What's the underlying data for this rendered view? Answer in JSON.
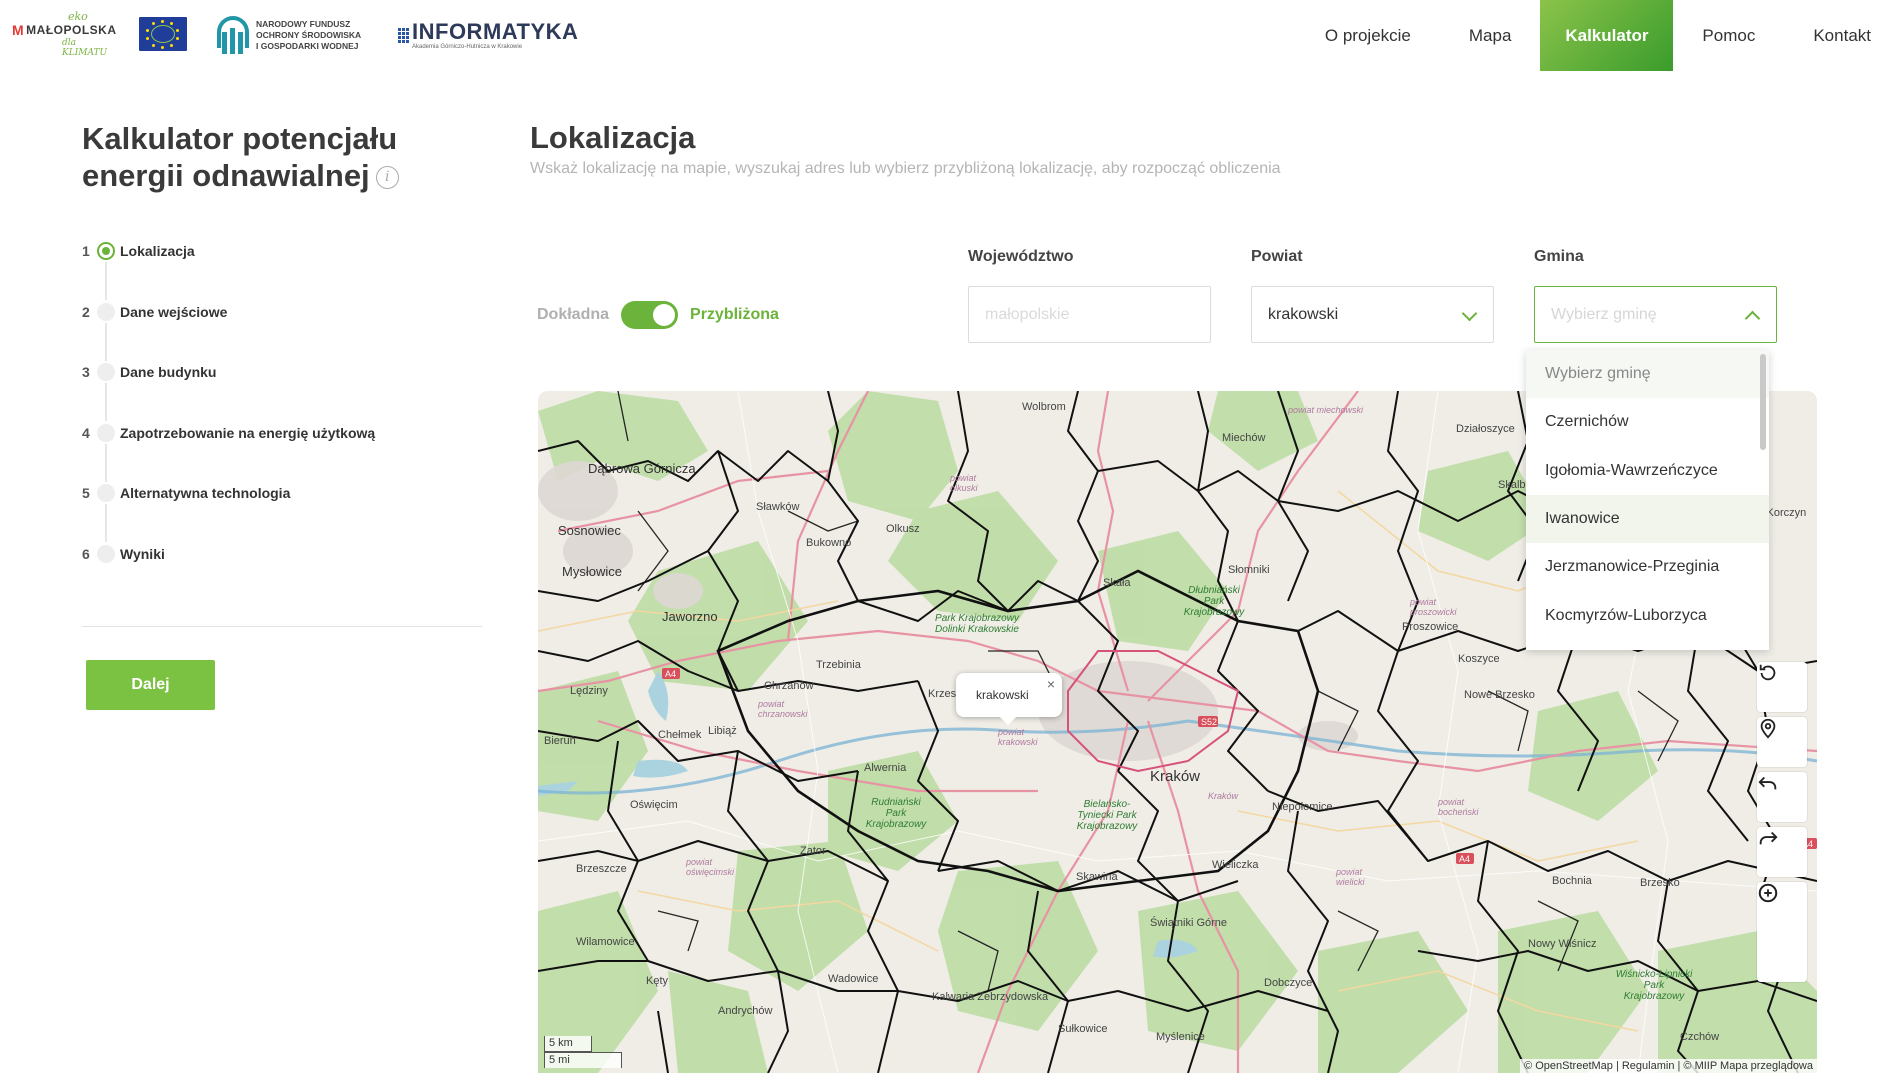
{
  "header": {
    "logos": {
      "malopolska_eko": "eko",
      "malopolska_name": "MAŁOPOLSKA",
      "malopolska_sub": "dla KLIMATU",
      "nfos_line1": "NARODOWY FUNDUSZ",
      "nfos_line2": "OCHRONY ŚRODOWISKA",
      "nfos_line3": "I GOSPODARKI WODNEJ",
      "inf_title": "INFORMATYKA",
      "inf_sub": "Akademia Górniczo-Hutnicza w Krakowie"
    },
    "nav": [
      {
        "label": "O projekcie"
      },
      {
        "label": "Mapa"
      },
      {
        "label": "Kalkulator",
        "active": true
      },
      {
        "label": "Pomoc"
      },
      {
        "label": "Kontakt"
      }
    ]
  },
  "sidebar": {
    "title": "Kalkulator potencjału energii odnawialnej",
    "info_icon": "info-icon",
    "steps": [
      {
        "num": "1",
        "label": "Lokalizacja",
        "active": true
      },
      {
        "num": "2",
        "label": "Dane wejściowe"
      },
      {
        "num": "3",
        "label": "Dane budynku"
      },
      {
        "num": "4",
        "label": "Zapotrzebowanie na energię użytkową"
      },
      {
        "num": "5",
        "label": "Alternatywna technologia"
      },
      {
        "num": "6",
        "label": "Wyniki"
      }
    ],
    "next_button": "Dalej"
  },
  "main": {
    "title": "Lokalizacja",
    "subtitle": "Wskaż lokalizację na mapie, wyszukaj adres lub wybierz przybliżoną lokalizację, aby rozpocząć obliczenia",
    "toggle": {
      "off_label": "Dokładna",
      "on_label": "Przybliżona",
      "state": "on"
    },
    "fields": {
      "wojewodztwo": {
        "label": "Województwo",
        "value": "małopolskie"
      },
      "powiat": {
        "label": "Powiat",
        "value": "krakowski"
      },
      "gmina": {
        "label": "Gmina",
        "placeholder": "Wybierz gminę"
      }
    },
    "dropdown": {
      "options": [
        "Wybierz gminę",
        "Czernichów",
        "Igołomia-Wawrzeńczyce",
        "Iwanowice",
        "Jerzmanowice-Przeginia",
        "Kocmyrzów-Luborzyca"
      ],
      "hovered": "Iwanowice"
    }
  },
  "map": {
    "popup": "krakowski",
    "labels": [
      {
        "t": "Wolbrom"
      },
      {
        "t": "Miechów"
      },
      {
        "t": "Działoszyce"
      },
      {
        "t": "Dąbrowa Górnicza"
      },
      {
        "t": "Sławków"
      },
      {
        "t": "Olkusz"
      },
      {
        "t": "Bukowno"
      },
      {
        "t": "Skalbmierz"
      },
      {
        "t": "Sosnowiec"
      },
      {
        "t": "Mysłowice"
      },
      {
        "t": "Słomniki"
      },
      {
        "t": "Skała"
      },
      {
        "t": "Jaworzno"
      },
      {
        "t": "Proszowice"
      },
      {
        "t": "Trzebinia"
      },
      {
        "t": "Chrzanów"
      },
      {
        "t": "Koszyce"
      },
      {
        "t": "Lędziny"
      },
      {
        "t": "Krzeszowice"
      },
      {
        "t": "Nowe Brzesko"
      },
      {
        "t": "Libiąż"
      },
      {
        "t": "Bieruń"
      },
      {
        "t": "Chełmek"
      },
      {
        "t": "Alwernia"
      },
      {
        "t": "Kraków"
      },
      {
        "t": "Oświęcim"
      },
      {
        "t": "Niepołomice"
      },
      {
        "t": "Zator"
      },
      {
        "t": "Brzeszcze"
      },
      {
        "t": "Skawina"
      },
      {
        "t": "Wieliczka"
      },
      {
        "t": "Bochnia"
      },
      {
        "t": "Brzesko"
      },
      {
        "t": "Wilamowice"
      },
      {
        "t": "Świątniki Górne"
      },
      {
        "t": "Nowy Wiśnicz"
      },
      {
        "t": "Kęty"
      },
      {
        "t": "Wadowice"
      },
      {
        "t": "Kalwaria Zebrzydowska"
      },
      {
        "t": "Dobczyce"
      },
      {
        "t": "Andrychów"
      },
      {
        "t": "Sułkowice"
      },
      {
        "t": "Myślenice"
      },
      {
        "t": "Czchów"
      },
      {
        "t": "Nowy Korczyn"
      }
    ],
    "road_labels": [
      "A4",
      "S52",
      "A4",
      "A4"
    ],
    "green_labels": [
      "Park Krajobrazowy Dolinki Krakowskie",
      "Dłubniański Park Krajobrazowy",
      "Rudniański Park Krajobrazowy",
      "Bielańsko-Tyniecki Park Krajobrazowy",
      "Wiśnicko-Lipnicki Park Krajobrazowy"
    ],
    "pink_labels": [
      "powiat olkuski",
      "powiat miechowski",
      "powiat proszowicki",
      "powiat chrzanowski",
      "powiat krakowski",
      "powiat oświęcimski",
      "Kraków",
      "powiat bocheński",
      "powiat wielicki"
    ],
    "controls": [
      "rotate-icon",
      "location-pin-icon",
      "undo-icon",
      "redo-icon",
      "zoom-in-icon",
      "zoom-out-icon"
    ],
    "scale": [
      "5 km",
      "5 mi"
    ],
    "attribution": "© OpenStreetMap | Regulamin | © MIIP Mapa przeglądowa"
  }
}
